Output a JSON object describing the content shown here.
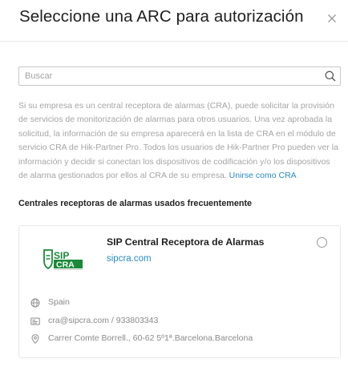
{
  "dialog": {
    "title": "Seleccione una ARC para autorización",
    "close_icon": "close-icon"
  },
  "search": {
    "placeholder": "Buscar",
    "value": "",
    "icon": "search-icon"
  },
  "description": {
    "text": "Si su empresa es un central receptora de alarmas (CRA), puede solicitar la provisión de servicios de monitorización de alarmas para otros usuarios. Una vez aprobada la solicitud, la información de su empresa aparecerá en la lista de CRA en el módulo de servicio CRA de Hik-Partner Pro. Todos los usuarios de Hik-Partner Pro pueden ver la información y decidir si conectan los dispositivos de codificación y/o los dispositivos de alarma gestionados por ellos al CRA de su empresa. ",
    "link_label": "Unirse como CRA"
  },
  "section": {
    "title": "Centrales receptoras de alarmas usados frecuentemente"
  },
  "arc_card": {
    "logo_top": "SIP",
    "logo_bottom": "CRA",
    "name": "SIP Central Receptora de Alarmas",
    "website": "sipcra.com",
    "selected": false,
    "country": "Spain",
    "contact": "cra@sipcra.com / 933803343",
    "address": "Carrer Comte Borrell., 60-62 5º1ª.Barcelona.Barcelona",
    "icons": {
      "country": "globe-icon",
      "contact": "contact-card-icon",
      "address": "location-pin-icon"
    },
    "brand_color": "#1a8a3a"
  },
  "colors": {
    "link": "#2a8bc7",
    "muted_text": "#a5a5a5"
  }
}
